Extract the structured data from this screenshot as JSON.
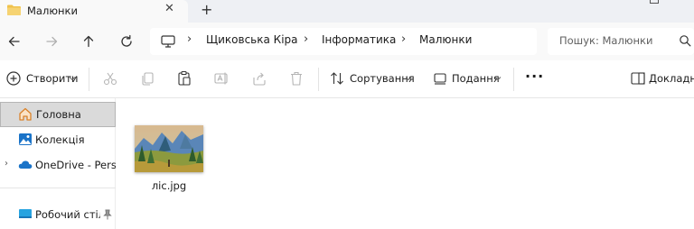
{
  "window": {
    "tab_title": "Малюнки",
    "close_glyph": "✕",
    "new_tab_glyph": "+"
  },
  "address": {
    "breadcrumbs": [
      "Щиковська Кіра",
      "Інформатика",
      "Малюнки"
    ],
    "search_placeholder": "Пошук: Малюнки"
  },
  "toolbar": {
    "create_label": "Створити",
    "sort_label": "Сортування",
    "view_label": "Подання",
    "details_label": "Докладно"
  },
  "sidebar": {
    "items": [
      {
        "label": "Головна"
      },
      {
        "label": "Колекція"
      },
      {
        "label": "OneDrive - Personal"
      },
      {
        "label": "Робочий стіл"
      }
    ]
  },
  "files": [
    {
      "name": "ліс.jpg"
    }
  ],
  "colors": {
    "folder": "#f0c24b",
    "accent": "#1a73c8",
    "selected": "#dadada"
  }
}
